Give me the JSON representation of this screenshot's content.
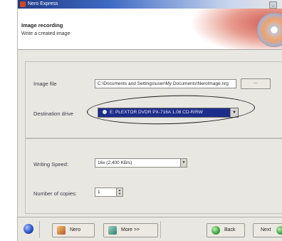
{
  "window": {
    "title": "Nero Express",
    "min_glyph": "_"
  },
  "header": {
    "title": "Image recording",
    "subtitle": "Write a created image"
  },
  "form": {
    "image_file": {
      "label": "Image file",
      "value": "C:\\Documents and Settings\\user\\My Documents\\NeroImage.nrg",
      "browse_label": "..."
    },
    "destination_drive": {
      "label": "Destination drive",
      "value": "E:  PLEXTOR  DVDR  PX-716A  1.08  CD-R/RW"
    },
    "writing_speed": {
      "label": "Writing Speed:",
      "value": "16x (2,400 KB/s)"
    },
    "copies": {
      "label": "Number of copies:",
      "value": "1"
    }
  },
  "footer": {
    "buttons": [
      {
        "label": "Nero"
      },
      {
        "label": "More >>"
      },
      {
        "label": "Back"
      },
      {
        "label": "Next"
      }
    ]
  },
  "icons": {
    "help": "help-icon",
    "nero": "nero-icon",
    "more": "more-icon",
    "back": "back-arrow-icon",
    "next": "next-arrow-icon"
  },
  "colors": {
    "title_bar": "#1f3b86",
    "combo_highlight": "#1d2d8a",
    "back_icon": "#3aa544"
  }
}
